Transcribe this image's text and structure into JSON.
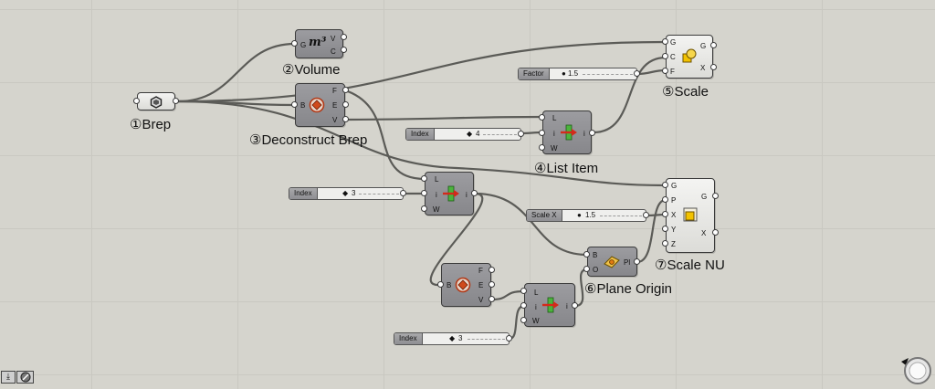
{
  "captions": {
    "brep": "①Brep",
    "volume": "②Volume",
    "deconstruct": "③Deconstruct Brep",
    "list_item": "④List Item",
    "scale": "⑤Scale",
    "plane_origin": "⑥Plane Origin",
    "scale_nu": "⑦Scale NU"
  },
  "volume": {
    "inputs": [
      "G"
    ],
    "outputs": [
      "V",
      "C"
    ],
    "icon_text": "m³"
  },
  "deconstruct1": {
    "inputs": [
      "B"
    ],
    "outputs": [
      "F",
      "E",
      "V"
    ]
  },
  "deconstruct2": {
    "inputs": [
      "B"
    ],
    "outputs": [
      "F",
      "E",
      "V"
    ]
  },
  "list_item1": {
    "inputs": [
      "L",
      "i",
      "W"
    ],
    "outputs": [
      "i"
    ]
  },
  "list_item2": {
    "inputs": [
      "L",
      "i",
      "W"
    ],
    "outputs": [
      "i"
    ]
  },
  "list_item3": {
    "inputs": [
      "L",
      "i",
      "W"
    ],
    "outputs": [
      "i"
    ]
  },
  "scale": {
    "inputs": [
      "G",
      "C",
      "F"
    ],
    "outputs": [
      "G",
      "X"
    ]
  },
  "scale_nu": {
    "inputs": [
      "G",
      "P",
      "X",
      "Y",
      "Z"
    ],
    "outputs": [
      "G",
      "X"
    ]
  },
  "plane_origin": {
    "inputs": [
      "B",
      "O"
    ],
    "outputs": [
      "Pl"
    ]
  },
  "sliders": {
    "factor": {
      "name": "Factor",
      "value": "1.5"
    },
    "index1": {
      "name": "Index",
      "value": "4"
    },
    "index2": {
      "name": "Index",
      "value": "3"
    },
    "scale_x": {
      "name": "Scale X",
      "value": "1.5"
    },
    "index3": {
      "name": "Index",
      "value": "3"
    }
  },
  "colors": {
    "canvas": "#d5d4cd",
    "grid": "#c9c8c1",
    "wire": "#5b5b57",
    "component": "#8f8f93"
  },
  "icons": {
    "brep": "brep-icon",
    "volume": "volume-icon",
    "deconstruct": "deconstruct-brep-icon",
    "list_item": "list-item-icon",
    "scale": "scale-icon",
    "scale_nu": "scale-nu-icon",
    "plane_origin": "plane-origin-icon",
    "bottom_left": [
      "download-icon",
      "preview-icon"
    ],
    "bottom_right": "zoom-widget-icon"
  }
}
